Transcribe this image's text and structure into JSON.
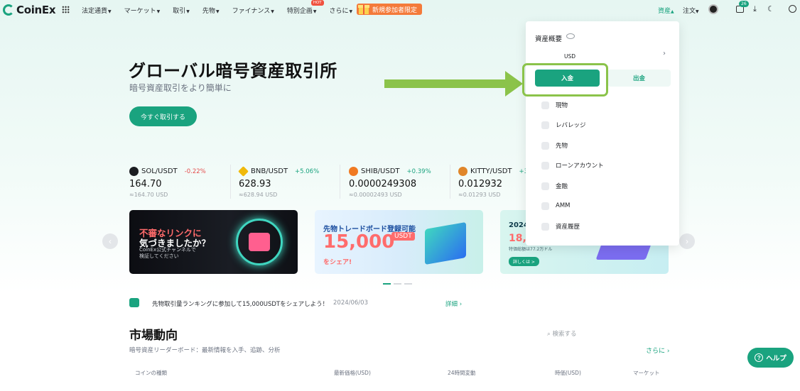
{
  "nav": {
    "logo": "CoinEx",
    "menu": [
      {
        "label": "法定通貨"
      },
      {
        "label": "マーケット"
      },
      {
        "label": "取引"
      },
      {
        "label": "先物"
      },
      {
        "label": "ファイナンス"
      },
      {
        "label": "特別企画",
        "badge": "HOT"
      },
      {
        "label": "さらに"
      }
    ],
    "promo": "新規参加者限定",
    "assets": "資産",
    "orders": "注文",
    "notification_count": "26"
  },
  "hero": {
    "title": "グローバル暗号資産取引所",
    "subtitle": "暗号資産取引をより簡単に",
    "cta": "今すぐ取引する"
  },
  "tickers": [
    {
      "symbol": "SOL/USDT",
      "change": "-0.22%",
      "price": "164.70",
      "usd": "≈164.70 USD",
      "color": "#e54d4d",
      "coin_color": "#1b1d21"
    },
    {
      "symbol": "BNB/USDT",
      "change": "+5.06%",
      "price": "628.93",
      "usd": "≈628.94 USD",
      "color": "#1aa37f",
      "coin_color": "#f0b90b"
    },
    {
      "symbol": "SHIB/USDT",
      "change": "+0.39%",
      "price": "0.0000249308",
      "usd": "≈0.00002493 USD",
      "color": "#1aa37f",
      "coin_color": "#f07a22"
    },
    {
      "symbol": "KITTY/USDT",
      "change": "+3",
      "price": "0.012932",
      "usd": "≈0.01293 USD",
      "color": "#1aa37f",
      "coin_color": "#e0862a"
    }
  ],
  "banners": [
    {
      "line1": "不審なリンクに",
      "line2": "気づきましたか？",
      "line3a": "CoinEx公式チャンネルで",
      "line3b": "検証してください"
    },
    {
      "line1": "先物トレードボード登録可能",
      "line2": "15,000",
      "badge": "USDT",
      "line3": "をシェア!"
    },
    {
      "line1": "2024",
      "line2": "18,0",
      "line3": "特価総額は77.2万ドル",
      "pill": "詳しくは >"
    }
  ],
  "notice": {
    "text": "先物取引量ランキングに参加して15,000USDTをシェアしよう！",
    "date": "2024/06/03",
    "more": "詳細 ›"
  },
  "market": {
    "title": "市場動向",
    "subtitle": "暗号資産リーダーボード：最新情報を入手、追跡、分析",
    "search_placeholder": "検索する",
    "more": "さらに ›",
    "columns": [
      "コインの種類",
      "最新価格(USD)",
      "24時間変動",
      "時価(USD)",
      "マーケット"
    ]
  },
  "dropdown": {
    "title": "資産概要",
    "currency": "USD",
    "deposit": "入金",
    "withdraw": "出金",
    "items": [
      {
        "label": "現物",
        "icon": "spot-icon"
      },
      {
        "label": "レバレッジ",
        "icon": "margin-icon"
      },
      {
        "label": "先物",
        "icon": "futures-icon"
      },
      {
        "label": "ローンアカウント",
        "icon": "loan-icon"
      },
      {
        "label": "金融",
        "icon": "finance-icon"
      },
      {
        "label": "AMM",
        "icon": "amm-icon"
      },
      {
        "label": "資産履歴",
        "icon": "history-icon"
      }
    ]
  },
  "help": "ヘルプ",
  "colors": {
    "accent": "#1aa37f",
    "promo": "#f47a3a",
    "highlight": "#8bc34a",
    "down": "#e54d4d"
  }
}
